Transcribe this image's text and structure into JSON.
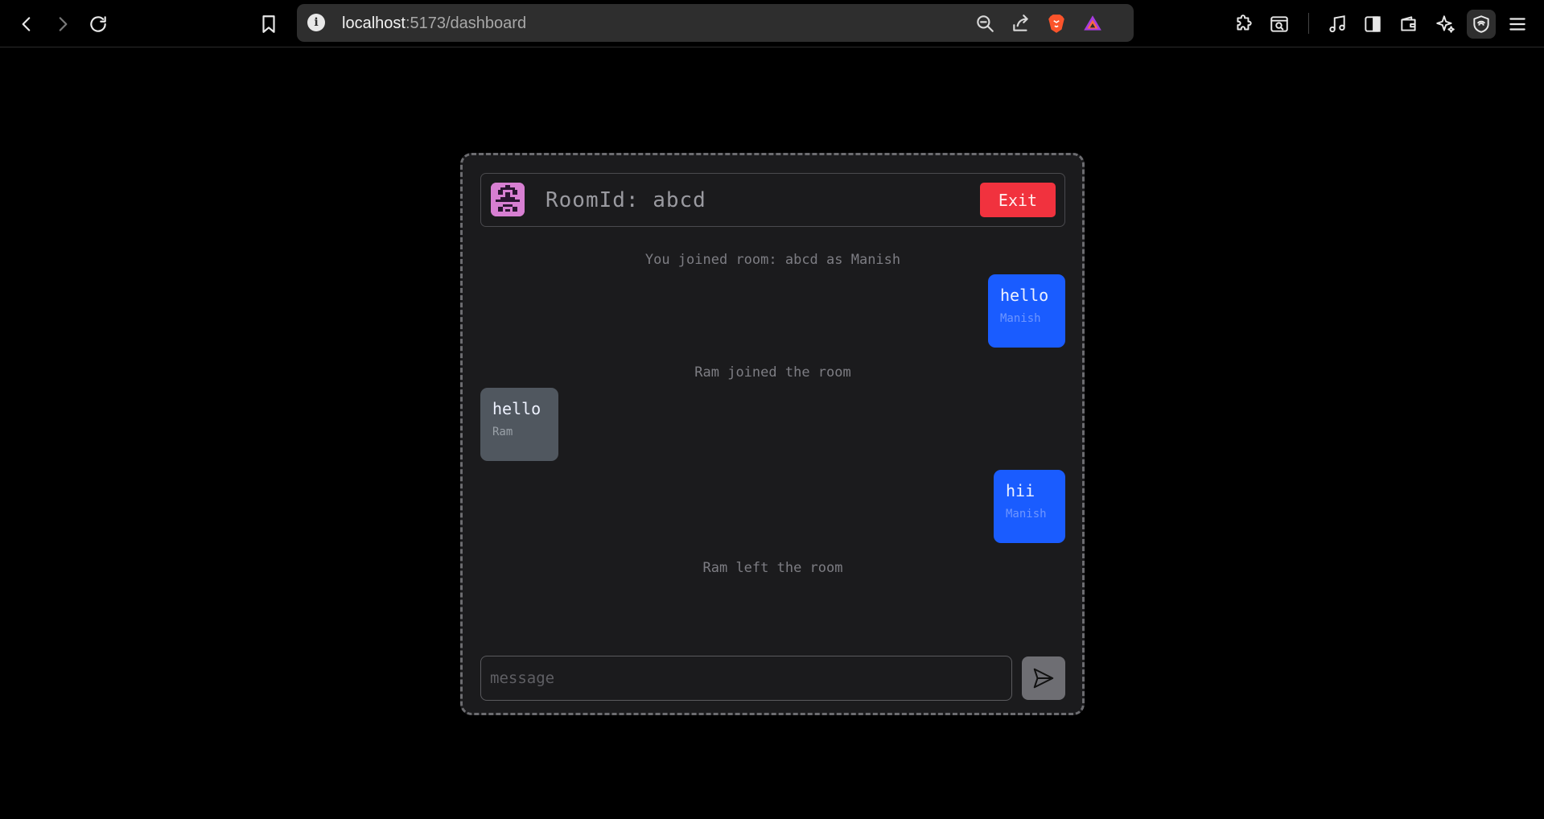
{
  "browser": {
    "url_host": "localhost",
    "url_path": ":5173/dashboard",
    "icons": {
      "back": "chevron-left-icon",
      "forward": "chevron-right-icon",
      "reload": "reload-icon",
      "bookmark": "bookmark-icon",
      "site_info": "info-icon",
      "zoom": "zoom-out-icon",
      "share": "share-icon",
      "brave_shields": "brave-lion-icon",
      "brave_rewards": "brave-rewards-icon",
      "extensions": "puzzle-icon",
      "search_tab": "search-tab-icon",
      "media": "music-note-icon",
      "sidebar": "sidebar-icon",
      "wallet": "wallet-icon",
      "leo": "sparkle-icon",
      "vpn": "shield-icon",
      "menu": "hamburger-menu-icon"
    }
  },
  "chat": {
    "room_label": "RoomId: abcd",
    "exit_label": "Exit",
    "avatar_icon": "pixel-avatar-icon",
    "events": [
      {
        "kind": "system",
        "text": "You joined room: abcd as Manish"
      },
      {
        "kind": "message",
        "side": "me",
        "text": "hello",
        "author": "Manish"
      },
      {
        "kind": "system",
        "text": "Ram joined the room"
      },
      {
        "kind": "message",
        "side": "other",
        "text": "hello",
        "author": "Ram"
      },
      {
        "kind": "message",
        "side": "me",
        "text": "hii",
        "author": "Manish"
      },
      {
        "kind": "system",
        "text": "Ram left the room"
      }
    ],
    "input_placeholder": "message",
    "send_icon": "send-icon"
  },
  "colors": {
    "page_bg": "#000000",
    "card_bg": "#1b1b1d",
    "my_bubble": "#1a5cff",
    "other_bubble": "#50575f",
    "exit_button": "#f1323e",
    "avatar_bg": "#d77fd2"
  }
}
